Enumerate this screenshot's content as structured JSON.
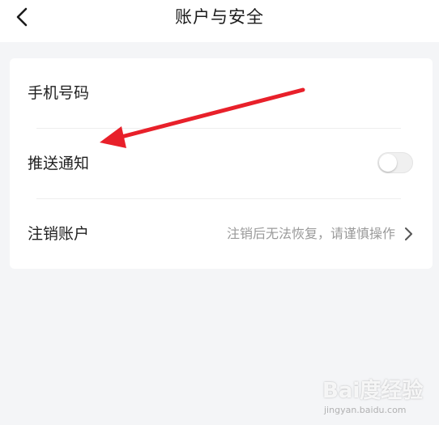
{
  "header": {
    "title": "账户与安全",
    "back_icon": "chevron-left-icon"
  },
  "settings": {
    "items": [
      {
        "label": "手机号码"
      },
      {
        "label": "推送通知",
        "toggle_on": false
      },
      {
        "label": "注销账户",
        "hint": "注销后无法恢复，请谨慎操作",
        "icon": "chevron-right-icon"
      }
    ]
  },
  "annotation": {
    "color": "#e8202a",
    "icon": "red-arrow-annotation"
  },
  "watermark": {
    "logo": "Bai度经验",
    "url": "jingyan.baidu.com"
  }
}
